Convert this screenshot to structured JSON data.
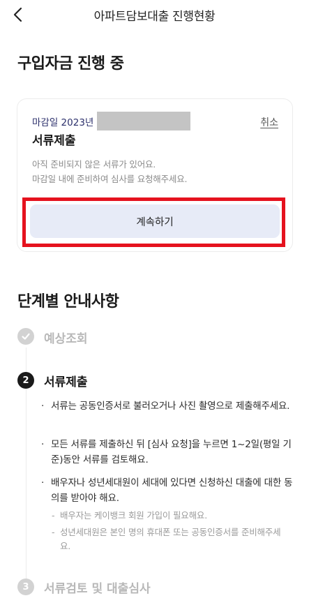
{
  "header": {
    "title": "아파트담보대출 진행현황",
    "back_icon": "chevron-left-icon"
  },
  "progress": {
    "title": "구입자금 진행 중",
    "card": {
      "deadline_label": "마감일 2023년",
      "step_name": "서류제출",
      "cancel_label": "취소",
      "notice_line1": "아직 준비되지 않은 서류가 있어요.",
      "notice_line2": "마감일 내에 준비하여 심사를 요청해주세요.",
      "continue_label": "계속하기"
    }
  },
  "guide": {
    "title": "단계별 안내사항",
    "steps": [
      {
        "marker": "✓",
        "label": "예상조회",
        "state": "done"
      },
      {
        "marker": "2",
        "label": "서류제출",
        "state": "active"
      },
      {
        "marker": "3",
        "label": "서류검토 및 대출심사",
        "state": "pending"
      }
    ],
    "bullets": [
      {
        "dot": "·",
        "text": "서류는 공동인증서로 불러오거나 사진 촬영으로 제출해주세요."
      },
      {
        "dot": "·",
        "text": "모든 서류를 제출하신 뒤 [심사 요청]을 누르면 1~2일(평일 기준)동안 서류를 검토해요."
      },
      {
        "dot": "·",
        "text": "배우자나 성년세대원이 세대에 있다면 신청하신 대출에 대한 동의를 받아야 해요."
      }
    ],
    "subnotes": [
      {
        "dash": "-",
        "text": "배우자는 케이뱅크 회원 가입이 필요해요."
      },
      {
        "dash": "-",
        "text": "성년세대원은 본인 명의 휴대폰 또는 공동인증서를 준비해주세요."
      }
    ]
  },
  "colors": {
    "accent_button": "#e7ebf7",
    "highlight_red": "#e5121e",
    "deadline_text": "#2b2f6b"
  }
}
